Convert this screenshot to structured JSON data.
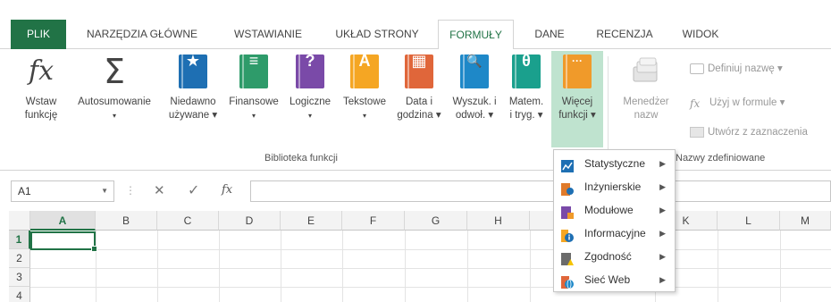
{
  "tabs": [
    {
      "label": "PLIK"
    },
    {
      "label": "NARZĘDZIA GŁÓWNE"
    },
    {
      "label": "WSTAWIANIE"
    },
    {
      "label": "UKŁAD STRONY"
    },
    {
      "label": "FORMUŁY"
    },
    {
      "label": "DANE"
    },
    {
      "label": "RECENZJA"
    },
    {
      "label": "WIDOK"
    }
  ],
  "ribbon": {
    "insert_function": {
      "line1": "Wstaw",
      "line2": "funkcję",
      "icon": "fx"
    },
    "autosum": {
      "line1": "Autosumowanie",
      "line2": "▾",
      "icon": "Σ"
    },
    "recent": {
      "line1": "Niedawno",
      "line2": "używane ▾",
      "icon": "★"
    },
    "financial": {
      "line1": "Finansowe",
      "line2": "▾",
      "icon": "≡"
    },
    "logical": {
      "line1": "Logiczne",
      "line2": "▾",
      "icon": "?"
    },
    "text": {
      "line1": "Tekstowe",
      "line2": "▾",
      "icon": "A"
    },
    "datetime": {
      "line1": "Data i",
      "line2": "godzina ▾",
      "icon": "▦"
    },
    "lookup": {
      "line1": "Wyszuk. i",
      "line2": "odwoł. ▾",
      "icon": "🔍"
    },
    "math": {
      "line1": "Matem.",
      "line2": "i tryg. ▾",
      "icon": "θ"
    },
    "more": {
      "line1": "Więcej",
      "line2": "funkcji ▾",
      "icon": "···"
    },
    "library_group": "Biblioteka funkcji",
    "name_manager": {
      "line1": "Menedżer",
      "line2": "nazw"
    },
    "define_name": "Definiuj nazwę ▾",
    "use_in_formula": "Użyj w formule ▾",
    "create_from_selection": "Utwórz z zaznaczenia",
    "names_group": "Nazwy zdefiniowane"
  },
  "formula_bar": {
    "name_box": "A1",
    "fx_label": "fx",
    "cancel": "✕",
    "enter": "✓",
    "value": ""
  },
  "columns": [
    "A",
    "B",
    "C",
    "D",
    "E",
    "F",
    "G",
    "H",
    "",
    "K",
    "L",
    "M"
  ],
  "rows": [
    "1",
    "2",
    "3",
    "4"
  ],
  "menu": {
    "items": [
      {
        "label": "Statystyczne",
        "icon": "chart-icon"
      },
      {
        "label": "Inżynierskie",
        "icon": "engineering-icon"
      },
      {
        "label": "Modułowe",
        "icon": "cube-icon"
      },
      {
        "label": "Informacyjne",
        "icon": "info-icon"
      },
      {
        "label": "Zgodność",
        "icon": "compat-icon"
      },
      {
        "label": "Sieć Web",
        "icon": "web-icon"
      }
    ],
    "arrow": "▶"
  },
  "colors": {
    "accent": "#217346",
    "recent": "#1e6fb3",
    "financial": "#2e9b6a",
    "logical": "#7a4aa8",
    "text": "#f5a623",
    "datetime": "#e0663a",
    "lookup": "#1e88c8",
    "math": "#1aa08d",
    "more": "#f09a2a",
    "selected_bg": "#bfe3cf"
  }
}
